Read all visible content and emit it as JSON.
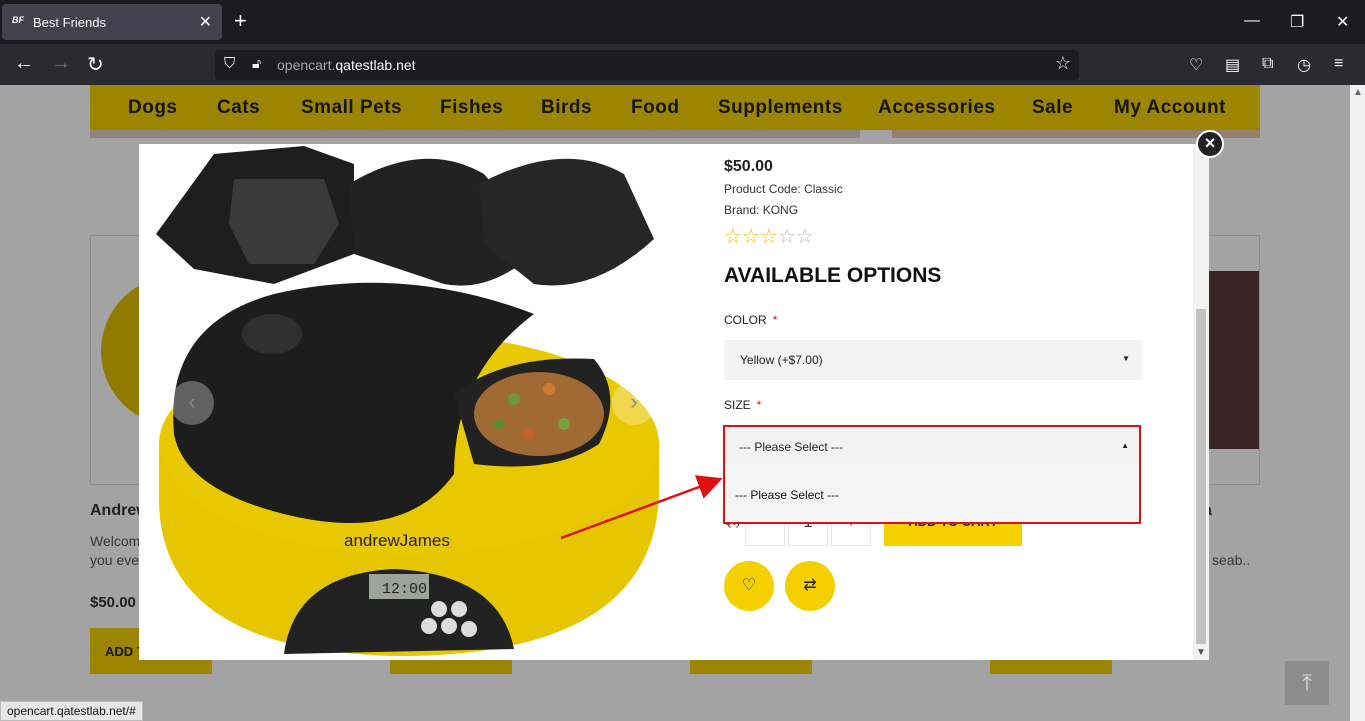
{
  "browser": {
    "tab_title": "Best Friends",
    "tab_favicon": "BF",
    "url_host": "opencart.",
    "url_domain": "qatestlab.net",
    "status_url": "opencart.qatestlab.net/#"
  },
  "menu": {
    "items": [
      "Dogs",
      "Cats",
      "Small Pets",
      "Fishes",
      "Birds",
      "Food",
      "Supplements",
      "Accessories",
      "Sale",
      "My Account"
    ]
  },
  "background": {
    "card1_title": "Andrew",
    "card1_text1": "Welcom",
    "card1_text2": "you ever",
    "card1_price": "$50.00",
    "card1_btn": "ADD T",
    "card4_title": "a",
    "card4_text": "l seab.."
  },
  "modal": {
    "price": "$50.00",
    "product_code": "Product Code: Classic",
    "brand": "Brand: KONG",
    "rating": 3,
    "rating_max": 5,
    "options_title": "AVAILABLE OPTIONS",
    "color_label": "COLOR",
    "color_value": "Yellow (+$7.00)",
    "size_label": "SIZE",
    "size_value": "--- Please Select ---",
    "size_options": [
      "--- Please Select ---"
    ],
    "qty_label": "Qty",
    "qty_minus": "-",
    "qty_value": "1",
    "qty_plus": "+",
    "add_to_cart": "ADD TO CART",
    "required_mark": "*",
    "product_brand_text": "andrewJames",
    "lcd_time": "12:00"
  },
  "colors": {
    "accent": "#f5d000",
    "annotation": "#e01010"
  }
}
